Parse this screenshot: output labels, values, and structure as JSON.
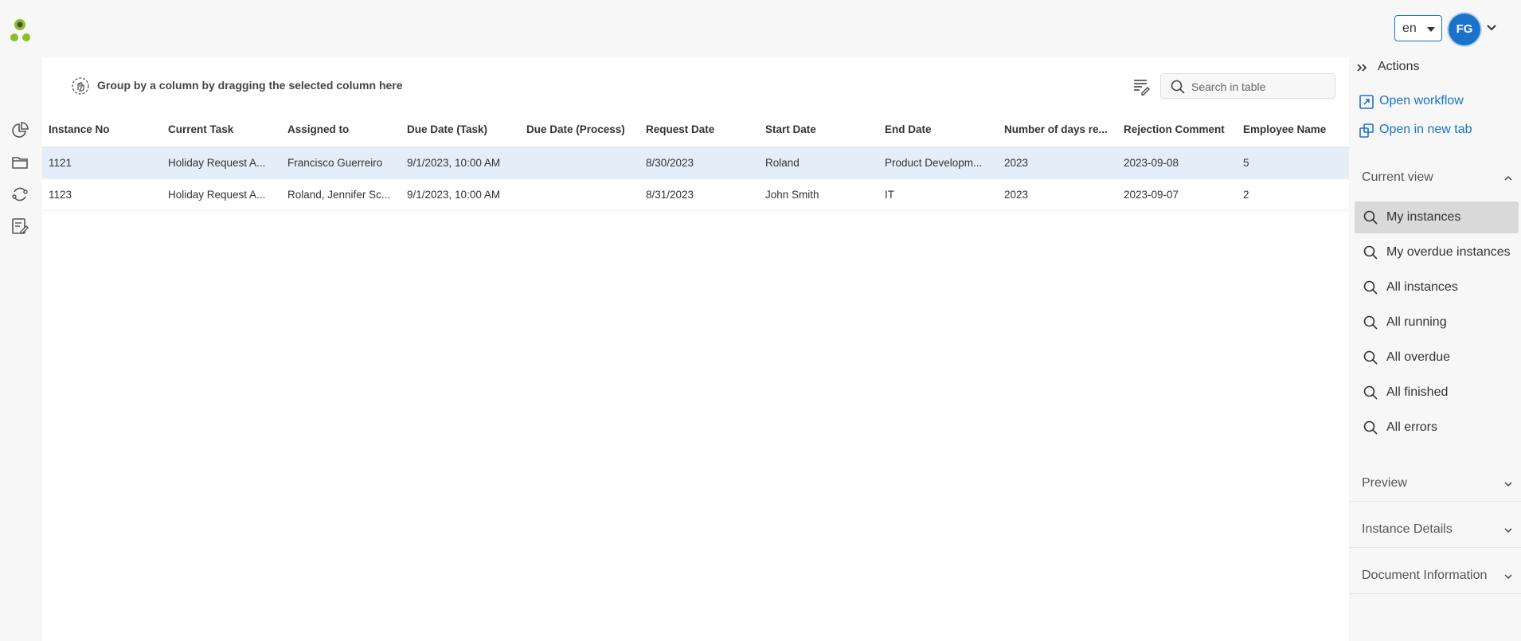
{
  "header": {
    "language": "en",
    "user_initials": "FG"
  },
  "table": {
    "group_by_hint": "Group by a column by dragging the selected column here",
    "search_placeholder": "Search in table",
    "columns": [
      "Instance No",
      "Current Task",
      "Assigned to",
      "Due Date (Task)",
      "Due Date (Process)",
      "Request Date",
      "Start Date",
      "End Date",
      "Number of days re...",
      "Rejection Comment",
      "Employee Name"
    ],
    "rows": [
      [
        "1121",
        "Holiday Request A...",
        "Francisco Guerreiro",
        "9/1/2023, 10:00 AM",
        "",
        "8/30/2023",
        "Roland",
        "Product Developm...",
        "2023",
        "2023-09-08",
        "5"
      ],
      [
        "1123",
        "Holiday Request A...",
        "Roland, Jennifer Sc...",
        "9/1/2023, 10:00 AM",
        "",
        "8/31/2023",
        "John Smith",
        "IT",
        "2023",
        "2023-09-07",
        "2"
      ]
    ],
    "selected_row": 0
  },
  "sidebar": {
    "title": "Actions",
    "actions": [
      {
        "label": "Open workflow",
        "icon": "external-link-icon"
      },
      {
        "label": "Open in new tab",
        "icon": "new-tab-icon"
      }
    ],
    "current_view": {
      "label": "Current view",
      "items": [
        "My instances",
        "My overdue instances",
        "All instances",
        "All running",
        "All overdue",
        "All finished",
        "All errors"
      ],
      "active_index": 0
    },
    "sections": [
      "Preview",
      "Instance Details",
      "Document Information"
    ]
  },
  "colors": {
    "accent": "#1a73c9",
    "selected_row": "#e3eef9",
    "logo_green": "#8cbf26",
    "logo_dark": "#4a4a4a"
  }
}
